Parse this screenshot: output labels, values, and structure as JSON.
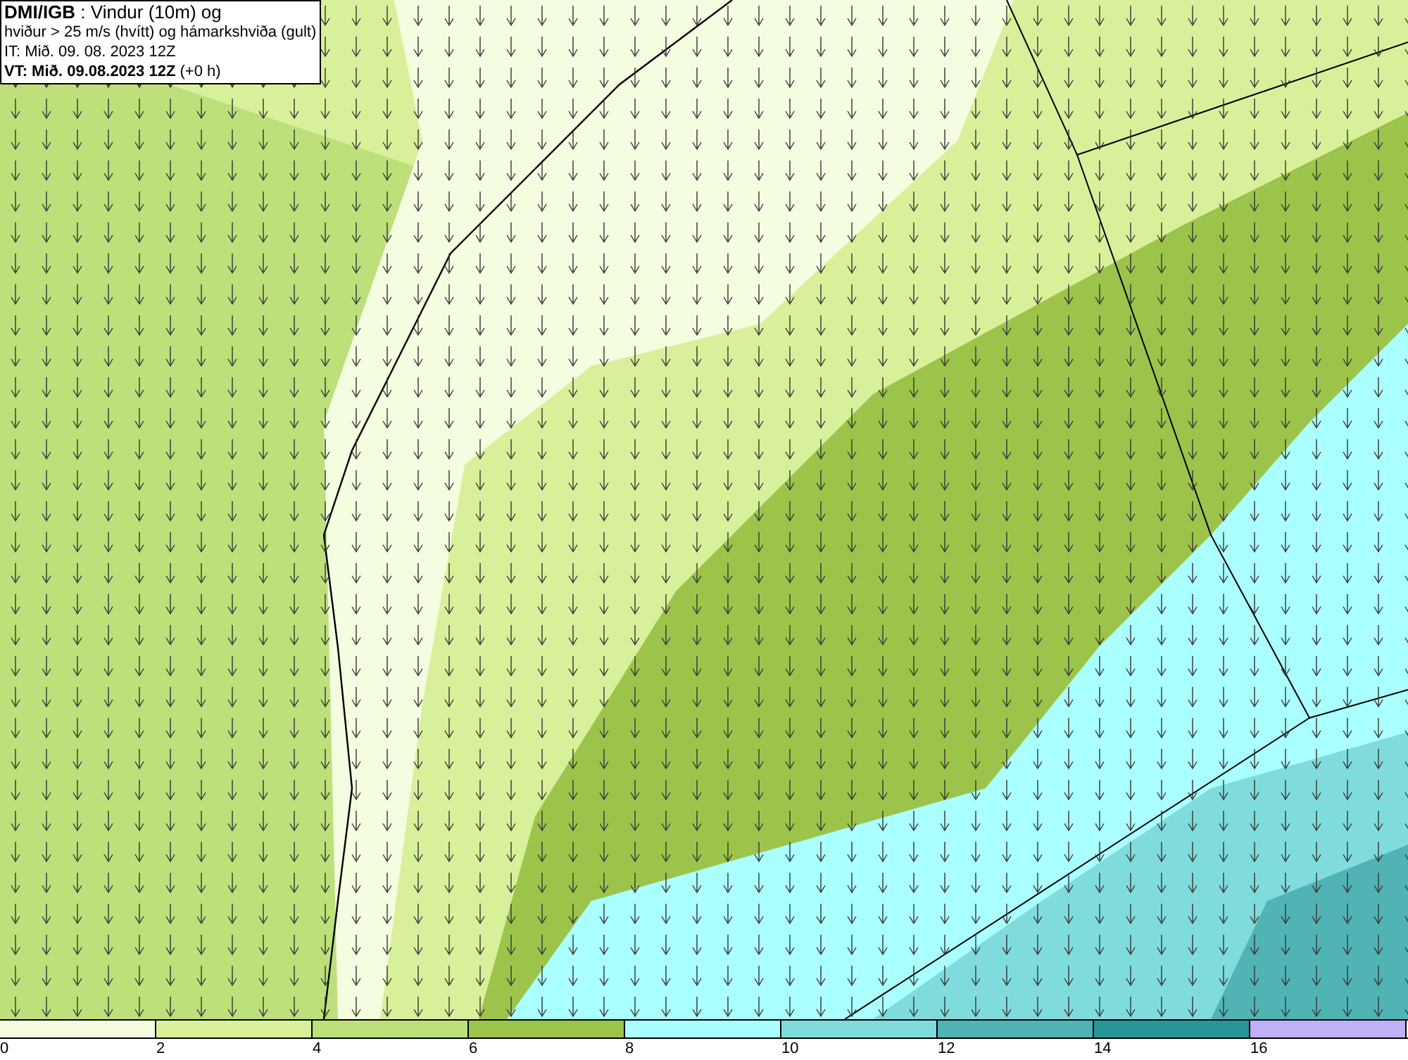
{
  "title_box": {
    "lines": [
      "**DMI/IGB** : Vindur (10m) og",
      "hviður > 25 m/s (hvítt) og hámarkshviða (gult)",
      "IT: Mið. 09. 08. 2023 12Z",
      "**VT: Mið. 09.08.2023 12Z** (+0 h)"
    ]
  },
  "legend": [
    {
      "label": "0",
      "color": "#f5fde0"
    },
    {
      "label": "2",
      "color": "#d9f09a"
    },
    {
      "label": "4",
      "color": "#bde07a"
    },
    {
      "label": "6",
      "color": "#9dc44a"
    },
    {
      "label": "8",
      "color": "#aaffff"
    },
    {
      "label": "10",
      "color": "#80dcdc"
    },
    {
      "label": "12",
      "color": "#50b4b4"
    },
    {
      "label": "14",
      "color": "#289696"
    },
    {
      "label": "16",
      "color": "#c0b0f8"
    }
  ]
}
